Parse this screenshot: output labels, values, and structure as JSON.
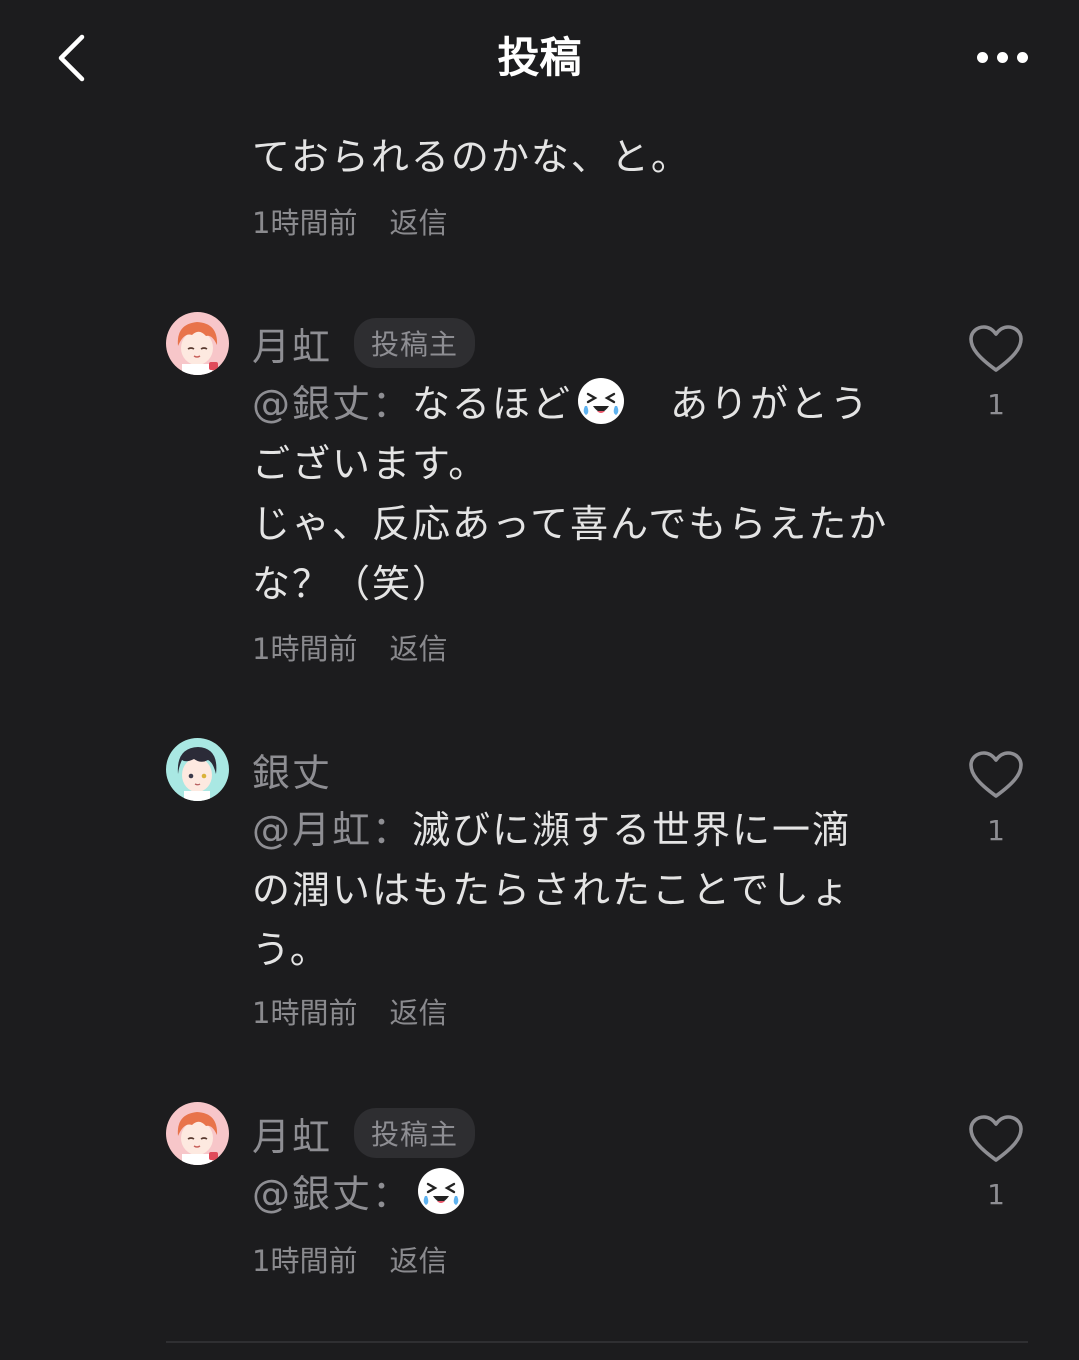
{
  "header": {
    "title": "投稿"
  },
  "partial_comment": {
    "text_tail": "ておられるのかな、と。",
    "time": "1時間前",
    "reply": "返信"
  },
  "comments": [
    {
      "author": "月虹",
      "badge": "投稿主",
      "mention": "@銀丈",
      "separator": "：",
      "text_before_emoji": "なるほど",
      "emoji": "laughing-tears-emoji",
      "text_after_emoji": "　ありがとうございます。\nじゃ、反応あって喜んでもらえたかな？（笑）",
      "time": "1時間前",
      "reply": "返信",
      "likes": "1"
    },
    {
      "author": "銀丈",
      "mention": "@月虹",
      "separator": "：",
      "text": "滅びに瀕する世界に一滴の潤いはもたらされたことでしょう。",
      "time": "1時間前",
      "reply": "返信",
      "likes": "1"
    },
    {
      "author": "月虹",
      "badge": "投稿主",
      "mention": "@銀丈",
      "separator": "：",
      "emoji": "laughing-tears-emoji",
      "time": "1時間前",
      "reply": "返信",
      "likes": "1"
    }
  ],
  "icons": {
    "back": "chevron-left-icon",
    "more": "more-dots-icon",
    "like": "heart-outline-icon"
  },
  "colors": {
    "background": "#1c1c1e",
    "text": "#e4e4e4",
    "muted": "#8e8e93",
    "badge_bg": "#2e2e31"
  }
}
